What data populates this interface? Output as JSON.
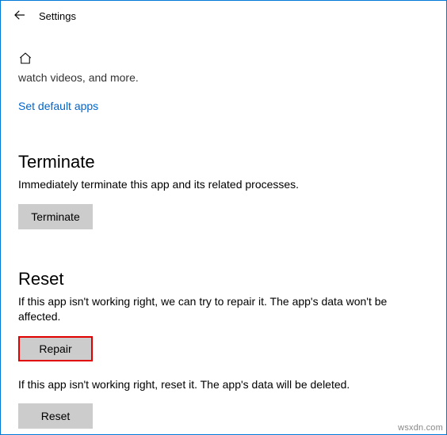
{
  "header": {
    "title": "Settings"
  },
  "truncated_line": "watch videos, and more.",
  "set_default_link": "Set default apps",
  "terminate": {
    "heading": "Terminate",
    "desc": "Immediately terminate this app and its related processes.",
    "button": "Terminate"
  },
  "reset": {
    "heading": "Reset",
    "repair_desc": "If this app isn't working right, we can try to repair it. The app's data won't be affected.",
    "repair_button": "Repair",
    "reset_desc": "If this app isn't working right, reset it. The app's data will be deleted.",
    "reset_button": "Reset"
  },
  "watermark": "wsxdn.com"
}
